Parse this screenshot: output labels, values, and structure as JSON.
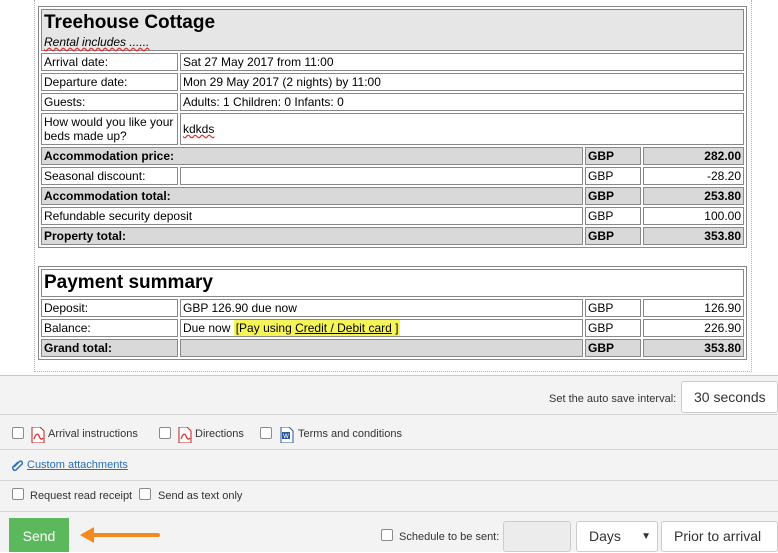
{
  "booking": {
    "property_name": "Treehouse Cottage",
    "rental_includes": "Rental includes ......",
    "rows": [
      {
        "label": "Arrival date:",
        "value": "Sat 27 May 2017 from 11:00"
      },
      {
        "label": "Departure date:",
        "value": "Mon 29 May 2017 (2 nights) by 11:00"
      },
      {
        "label": "Guests:",
        "value": "Adults: 1 Children: 0 Infants: 0"
      },
      {
        "label": "How would you like your beds made up?",
        "value": "kdkds"
      }
    ],
    "charges": {
      "accommodation_price": {
        "label": "Accommodation price:",
        "currency": "GBP",
        "amount": "282.00"
      },
      "seasonal_discount": {
        "label": "Seasonal discount:",
        "currency": "GBP",
        "amount": "-28.20"
      },
      "accommodation_total": {
        "label": "Accommodation total:",
        "currency": "GBP",
        "amount": "253.80"
      },
      "security_deposit": {
        "label": "Refundable security deposit",
        "currency": "GBP",
        "amount": "100.00"
      },
      "property_total": {
        "label": "Property total:",
        "currency": "GBP",
        "amount": "353.80"
      }
    }
  },
  "payment": {
    "title": "Payment summary",
    "deposit": {
      "label": "Deposit:",
      "desc": "GBP 126.90 due now",
      "currency": "GBP",
      "amount": "126.90"
    },
    "balance": {
      "label": "Balance:",
      "desc": "Due now",
      "link_open": "[Pay using ",
      "link_text": "Credit / Debit card",
      "link_close": " ]",
      "currency": "GBP",
      "amount": "226.90"
    },
    "grand_total": {
      "label": "Grand total:",
      "currency": "GBP",
      "amount": "353.80"
    }
  },
  "autosave": {
    "label": "Set the auto save interval:",
    "value": "30 seconds"
  },
  "attachments": {
    "arrival_instructions": "Arrival instructions",
    "directions": "Directions",
    "terms": "Terms and conditions",
    "custom": "Custom attachments"
  },
  "options": {
    "read_receipt": "Request read receipt",
    "send_text": "Send as text only"
  },
  "footer": {
    "send_label": "Send",
    "schedule_label": "Schedule to be sent:",
    "days_value": "Days",
    "prior_value": "Prior to arrival"
  },
  "colors": {
    "send": "#5cb85c",
    "arrow": "#f28a1e",
    "highlight": "#f5f55a",
    "link": "#2a6fb7"
  }
}
